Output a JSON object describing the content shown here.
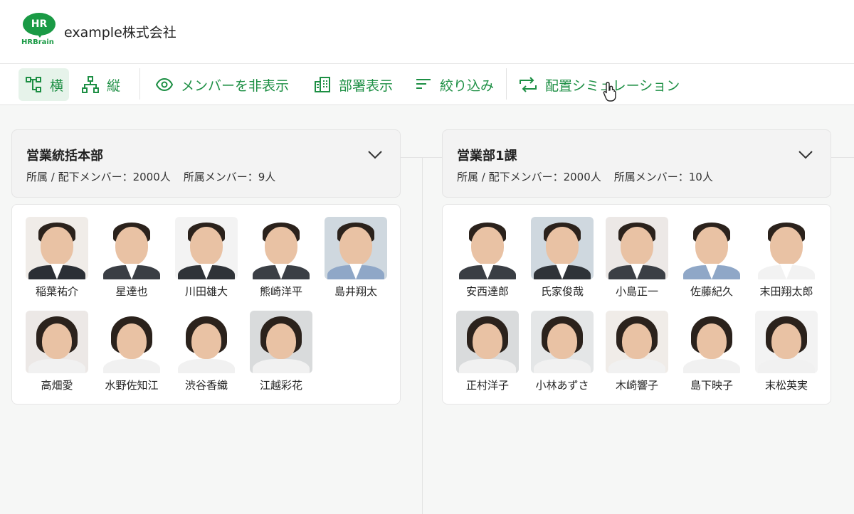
{
  "header": {
    "logo_text": "HR",
    "logo_brand": "HRBrain",
    "company": "example株式会社"
  },
  "toolbar": {
    "horizontal": "横",
    "vertical": "縦",
    "hide_members": "メンバーを非表示",
    "show_departments": "部署表示",
    "filter": "絞り込み",
    "simulation": "配置シミュレーション"
  },
  "departments": [
    {
      "name": "営業統括本部",
      "meta_under_label": "所属 / 配下メンバー：2000人",
      "meta_own_label": "所属メンバー：9人",
      "members": [
        "稲葉祐介",
        "星達也",
        "川田雄大",
        "熊崎洋平",
        "島井翔太",
        "高畑愛",
        "水野佐知江",
        "渋谷香織",
        "江越彩花"
      ]
    },
    {
      "name": "営業部1課",
      "meta_under_label": "所属 / 配下メンバー：2000人",
      "meta_own_label": "所属メンバー：10人",
      "members": [
        "安西達郎",
        "氏家俊哉",
        "小島正一",
        "佐藤紀久",
        "末田翔太郎",
        "正村洋子",
        "小林あずさ",
        "木崎響子",
        "島下映子",
        "末松英実"
      ]
    }
  ],
  "colors": {
    "accent": "#1d8f44",
    "brand": "#1a9a45"
  }
}
